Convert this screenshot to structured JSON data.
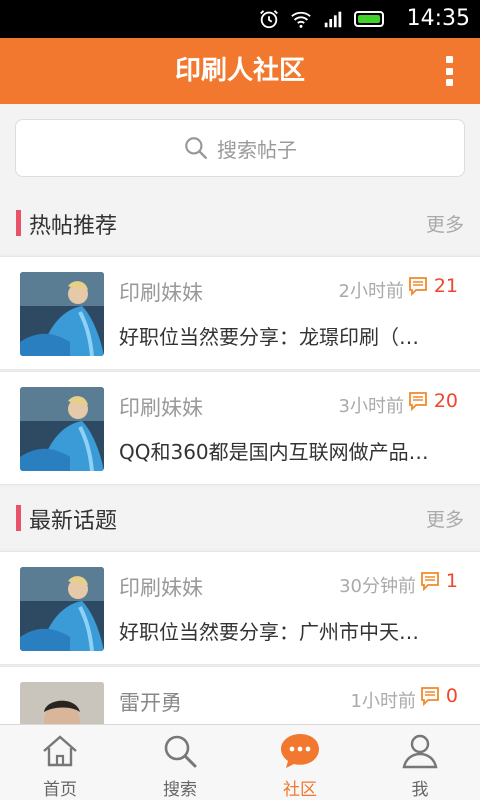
{
  "status_bar": {
    "time": "14:35"
  },
  "header": {
    "title": "印刷人社区"
  },
  "search": {
    "placeholder": "搜索帖子"
  },
  "hot_section": {
    "title": "热帖推荐",
    "more": "更多",
    "posts": [
      {
        "author": "印刷妹妹",
        "time": "2小时前",
        "comments": "21",
        "title": "好职位当然要分享：龙璟印刷（…"
      },
      {
        "author": "印刷妹妹",
        "time": "3小时前",
        "comments": "20",
        "title": "QQ和360都是国内互联网做产品…"
      }
    ]
  },
  "latest_section": {
    "title": "最新话题",
    "more": "更多",
    "posts": [
      {
        "author": "印刷妹妹",
        "time": "30分钟前",
        "comments": "1",
        "title": "好职位当然要分享：广州市中天…"
      },
      {
        "author": "雷开勇",
        "time": "1小时前",
        "comments": "0",
        "title": ""
      }
    ]
  },
  "bottom_nav": [
    {
      "label": "首页",
      "icon": "home-icon",
      "active": false
    },
    {
      "label": "搜索",
      "icon": "search-icon",
      "active": false
    },
    {
      "label": "社区",
      "icon": "chat-icon",
      "active": true
    },
    {
      "label": "我",
      "icon": "person-icon",
      "active": false
    }
  ],
  "colors": {
    "primary": "#f2782f",
    "section_bar": "#e8536a",
    "comment": "#f3442d"
  }
}
